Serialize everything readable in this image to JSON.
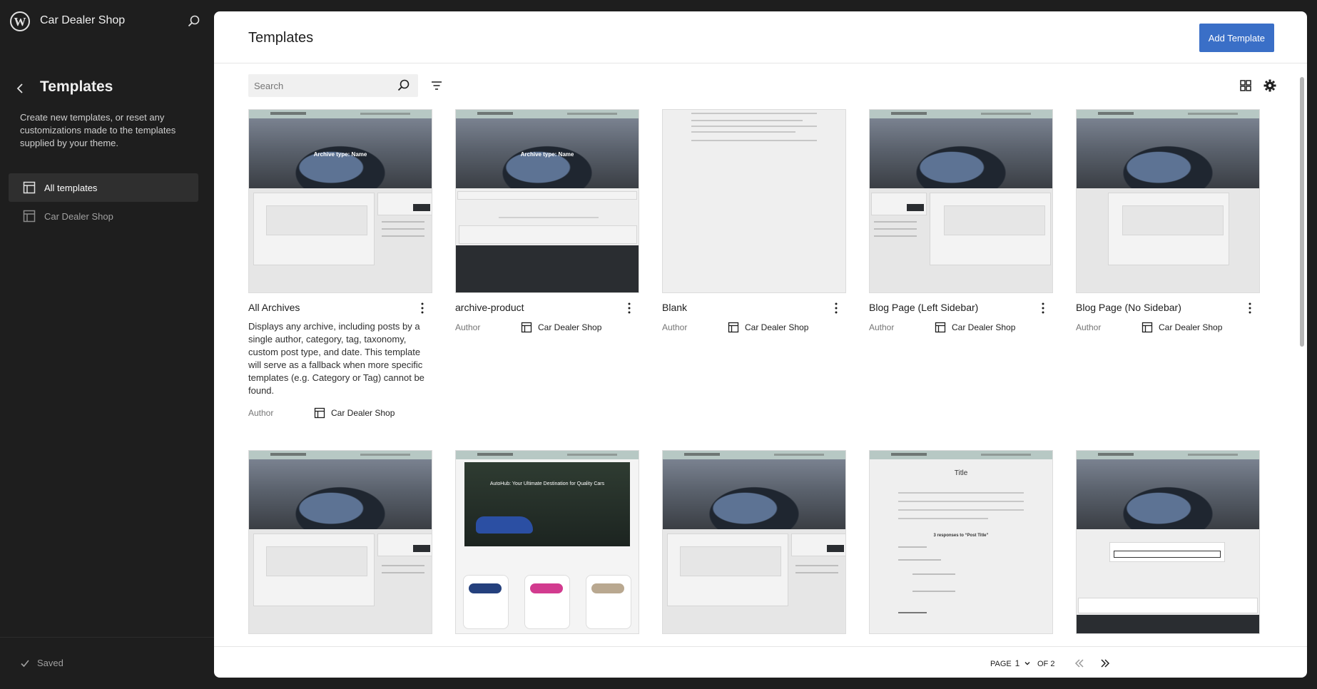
{
  "site": {
    "name": "Car Dealer Shop"
  },
  "sidebar": {
    "title": "Templates",
    "description": "Create new templates, or reset any customizations made to the templates supplied by your theme.",
    "items": [
      {
        "label": "All templates",
        "active": true
      },
      {
        "label": "Car Dealer Shop",
        "active": false
      }
    ],
    "saved_label": "Saved"
  },
  "main": {
    "title": "Templates",
    "add_button": "Add Template",
    "search": {
      "placeholder": "Search",
      "value": ""
    }
  },
  "templates": [
    {
      "title": "All Archives",
      "description": "Displays any archive, including posts by a single author, category, tag, taxonomy, custom post type, and date. This template will serve as a fallback when more specific templates (e.g. Category or Tag) cannot be found.",
      "author_label": "Author",
      "author": "Car Dealer Shop",
      "thumb_caption": "Archive type: Name"
    },
    {
      "title": "archive-product",
      "author_label": "Author",
      "author": "Car Dealer Shop",
      "thumb_caption": "Archive type: Name"
    },
    {
      "title": "Blank",
      "author_label": "Author",
      "author": "Car Dealer Shop"
    },
    {
      "title": "Blog Page (Left Sidebar)",
      "author_label": "Author",
      "author": "Car Dealer Shop"
    },
    {
      "title": "Blog Page (No Sidebar)",
      "author_label": "Author",
      "author": "Car Dealer Shop"
    }
  ],
  "row2_thumbs": [
    {
      "kind": "blog-right-sidebar"
    },
    {
      "kind": "home",
      "caption": "AutoHub: Your Ultimate Destination for Quality Cars"
    },
    {
      "kind": "blog-right-sidebar"
    },
    {
      "kind": "single",
      "caption": "Title",
      "subcaption": "3 responses to “Post Title”"
    },
    {
      "kind": "search"
    }
  ],
  "pagination": {
    "page_label": "PAGE",
    "current": "1",
    "of_label": "OF 2"
  },
  "colors": {
    "accent": "#3a6fc7",
    "sidebar_bg": "#1e1e1e"
  }
}
